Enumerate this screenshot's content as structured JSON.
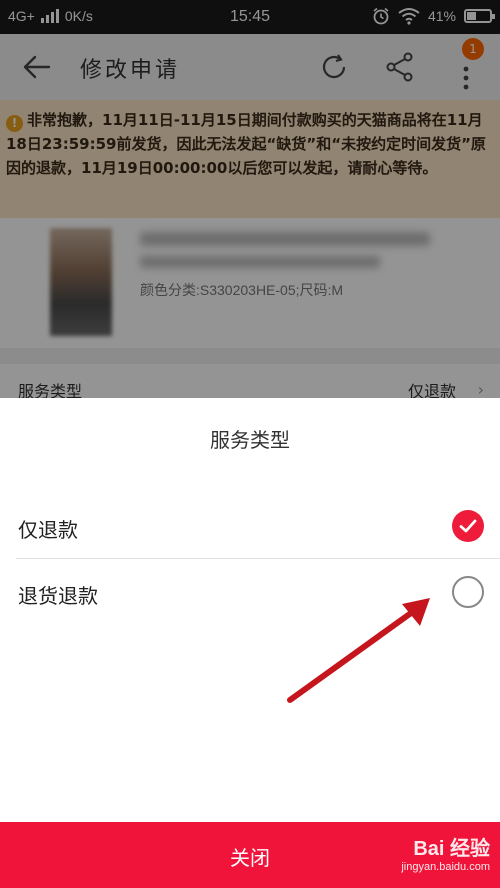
{
  "status_bar": {
    "network": "4G+",
    "speed": "0K/s",
    "time": "15:45",
    "battery": "41%",
    "battery_level": 0.41,
    "icons": [
      "signal-icon",
      "alarm-icon",
      "wifi-icon",
      "battery-icon"
    ]
  },
  "header": {
    "title": "修改申请",
    "badge_count": "1",
    "icons": [
      "back-arrow-icon",
      "refresh-icon",
      "share-icon",
      "more-icon"
    ]
  },
  "notice": {
    "text": "非常抱歉，11月11日-11月15日期间付款购买的天猫商品将在11月18日23:59:59前发货，因此无法发起“缺货”和“未按约定时间发货”原因的退款，11月19日00:00:00以后您可以发起，请耐心等待。"
  },
  "product": {
    "spec": "颜色分类:S330203HE-05;尺码:M"
  },
  "service_row": {
    "label": "服务类型",
    "value": "仅退款"
  },
  "sheet": {
    "title": "服务类型",
    "options": [
      {
        "label": "仅退款",
        "checked": true
      },
      {
        "label": "退货退款",
        "checked": false
      }
    ],
    "close_label": "关闭"
  },
  "watermark": {
    "main": "Bai  经验",
    "sub": "jingyan.baidu.com"
  },
  "colors": {
    "accent": "#f0143b",
    "checked": "#ee1b3a",
    "notice_bg": "#fbe3c4",
    "arrow": "#c4161c"
  }
}
